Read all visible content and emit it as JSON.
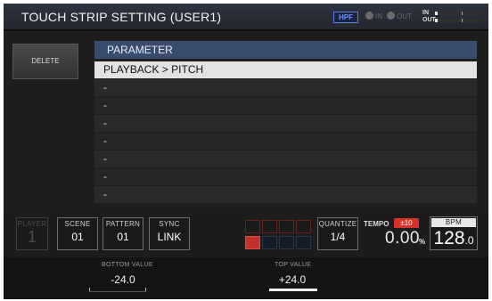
{
  "header": {
    "title": "TOUCH STRIP SETTING (USER1)",
    "hpf": "HPF",
    "in_label": "IN",
    "out_label": "OUT",
    "meter_in": "IN",
    "meter_out": "OUT"
  },
  "sidebar": {
    "delete_label": "DELETE"
  },
  "parameter": {
    "header": "PARAMETER",
    "rows": [
      "PLAYBACK > PITCH",
      "-",
      "-",
      "-",
      "-",
      "-",
      "-",
      "-"
    ],
    "selected_index": 0
  },
  "panel": {
    "player": {
      "label": "PLAYER",
      "value": "1"
    },
    "scene": {
      "label": "SCENE",
      "value": "01"
    },
    "pattern": {
      "label": "PATTERN",
      "value": "01"
    },
    "sync": {
      "label": "SYNC",
      "value": "LINK"
    },
    "quantize": {
      "label": "QUANTIZE",
      "value": "1/4"
    },
    "tempo": {
      "label": "TEMPO",
      "range": "±10",
      "value": "0.00",
      "unit": "%"
    },
    "bpm": {
      "label": "BPM",
      "value_int": "128",
      "value_dec": ".0"
    },
    "pads": {
      "rows": 2,
      "cols": 4,
      "active": [
        [
          1,
          0
        ]
      ]
    }
  },
  "footer": {
    "bottom": {
      "label": "BOTTOM VALUE",
      "value": "-24.0"
    },
    "top": {
      "label": "TOP VALUE",
      "value": "+24.0"
    }
  },
  "colors": {
    "accent_blue": "#3a4c6e",
    "hpf_blue": "#6d93ff",
    "active_red": "#c0332d",
    "selected_row": "#e2e2e2"
  }
}
